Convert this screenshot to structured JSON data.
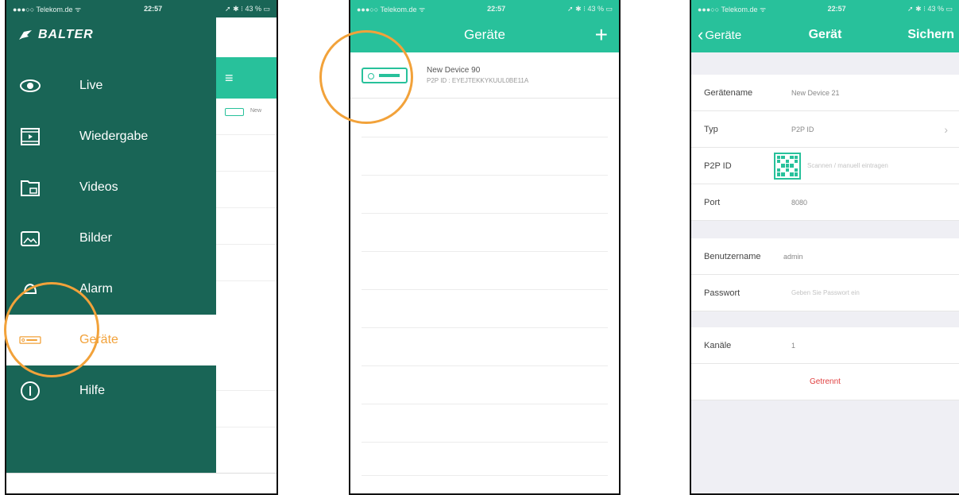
{
  "status_bar": {
    "carrier": "●●●○○ Telekom.de ᯤ",
    "time": "22:57",
    "battery": "➚ ✱ ⁝ 43 % ▭"
  },
  "screen1": {
    "brand": "BALTER",
    "menu_items": [
      {
        "label": "Live",
        "icon": "eye-icon"
      },
      {
        "label": "Wiedergabe",
        "icon": "playback-icon"
      },
      {
        "label": "Videos",
        "icon": "videos-folder-icon"
      },
      {
        "label": "Bilder",
        "icon": "pictures-icon"
      },
      {
        "label": "Alarm",
        "icon": "alarm-icon"
      },
      {
        "label": "Geräte",
        "icon": "device-icon"
      },
      {
        "label": "Hilfe",
        "icon": "info-icon"
      }
    ],
    "under_row_text": "New"
  },
  "screen2": {
    "title": "Geräte",
    "add": "+",
    "device": {
      "name": "New Device 90",
      "id": "P2P ID : EYEJTEKKYKUUL0BE11A"
    }
  },
  "screen3": {
    "back_label": "Geräte",
    "title": "Gerät",
    "save_label": "Sichern",
    "fields": {
      "name_label": "Gerätename",
      "name_value": "New Device 21",
      "type_label": "Typ",
      "type_value": "P2P ID",
      "p2p_label": "P2P ID",
      "p2p_placeholder": "Scannen / manuell eintragen",
      "port_label": "Port",
      "port_value": "8080",
      "user_label": "Benutzername",
      "user_value": "admin",
      "pass_label": "Passwort",
      "pass_placeholder": "Geben Sie Passwort ein",
      "channels_label": "Kanäle",
      "channels_value": "1"
    },
    "status": "Getrennt"
  },
  "colors": {
    "dark_green": "#196556",
    "accent_green": "#28c19b",
    "highlight_orange": "#f2a23a",
    "status_red": "#e04040"
  }
}
